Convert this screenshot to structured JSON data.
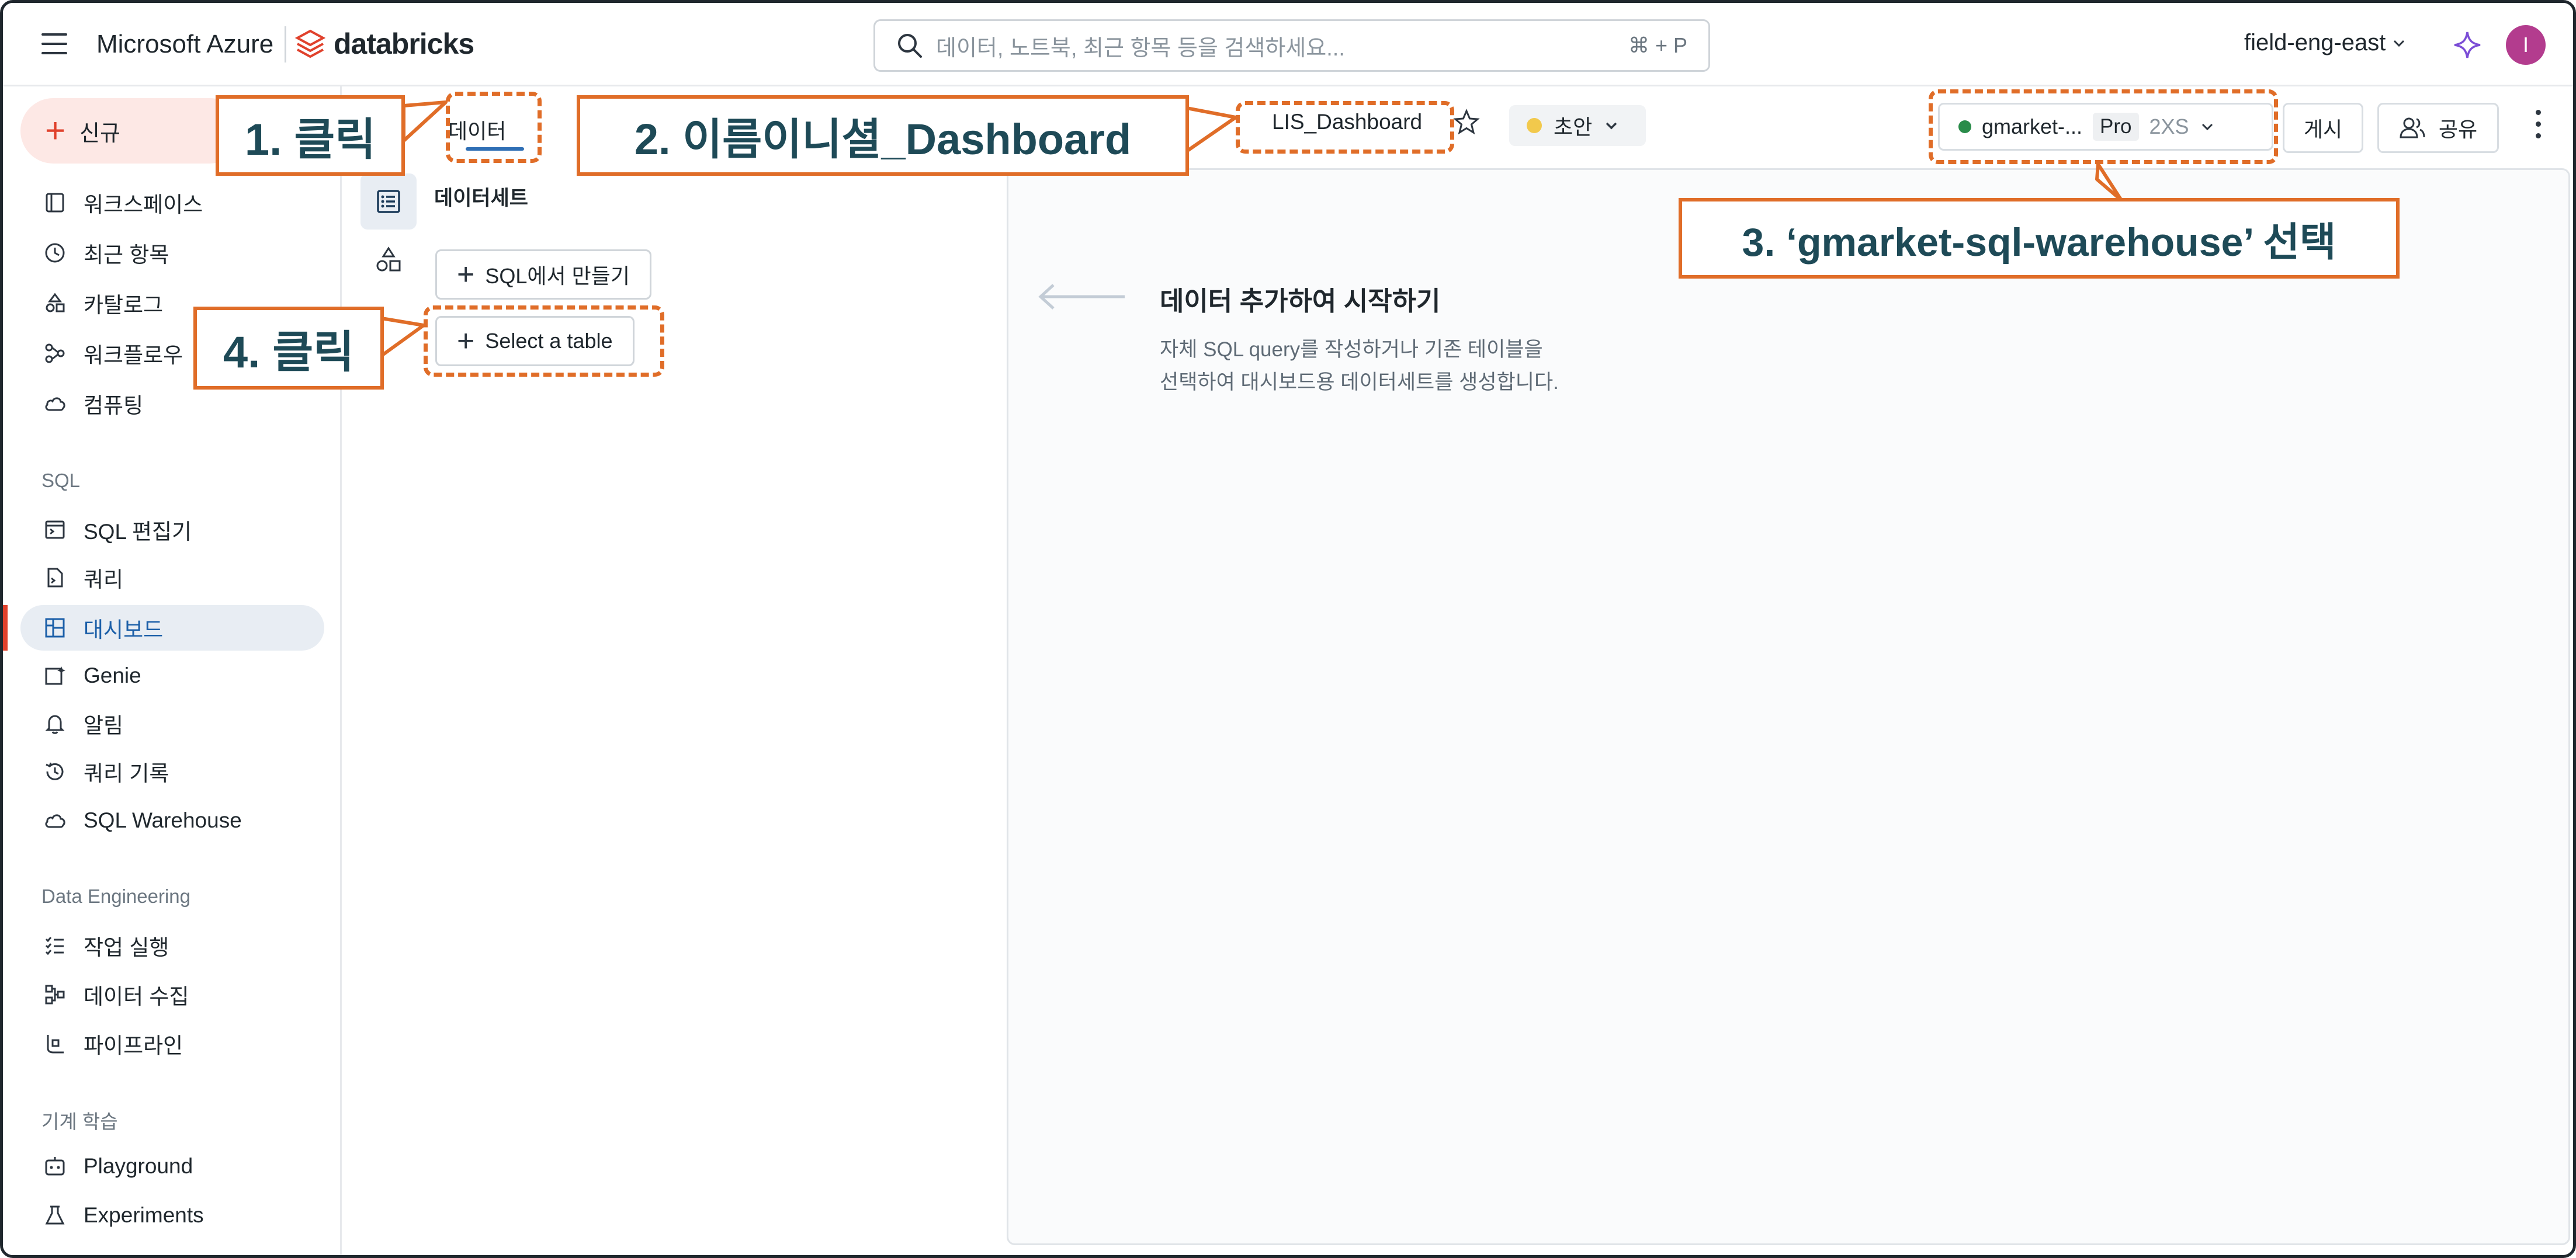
{
  "topbar": {
    "cloud_name": "Microsoft Azure",
    "brand_name": "databricks",
    "search_placeholder": "데이터, 노트북, 최근 항목 등을 검색하세요...",
    "search_shortcut": "⌘ + P",
    "workspace_name": "field-eng-east",
    "avatar_initial": "I"
  },
  "sidebar": {
    "new_label": "신규",
    "items": [
      {
        "label": "워크스페이스",
        "icon": "workspace-icon"
      },
      {
        "label": "최근 항목",
        "icon": "clock-icon"
      },
      {
        "label": "카탈로그",
        "icon": "catalog-icon"
      },
      {
        "label": "워크플로우",
        "icon": "workflow-icon"
      },
      {
        "label": "컴퓨팅",
        "icon": "cloud-icon"
      }
    ],
    "sql_section": "SQL",
    "sql_items": [
      {
        "label": "SQL 편집기",
        "icon": "sql-editor-icon"
      },
      {
        "label": "쿼리",
        "icon": "query-icon"
      },
      {
        "label": "대시보드",
        "icon": "dashboard-icon",
        "active": true
      },
      {
        "label": "Genie",
        "icon": "genie-icon"
      },
      {
        "label": "알림",
        "icon": "bell-icon"
      },
      {
        "label": "쿼리 기록",
        "icon": "history-icon"
      },
      {
        "label": "SQL Warehouse",
        "icon": "warehouse-icon"
      }
    ],
    "de_section": "Data Engineering",
    "de_items": [
      {
        "label": "작업 실행",
        "icon": "job-runs-icon"
      },
      {
        "label": "데이터 수집",
        "icon": "ingest-icon"
      },
      {
        "label": "파이프라인",
        "icon": "pipeline-icon"
      }
    ],
    "ml_section": "기계 학습",
    "ml_items": [
      {
        "label": "Playground",
        "icon": "playground-icon"
      },
      {
        "label": "Experiments",
        "icon": "experiments-icon"
      }
    ]
  },
  "dashboard": {
    "tab_data": "데이터",
    "title": "LIS_Dashboard",
    "status": "초안",
    "warehouse_name": "gmarket-...",
    "warehouse_tier": "Pro",
    "warehouse_size": "2XS",
    "publish_label": "게시",
    "share_label": "공유"
  },
  "data_panel": {
    "datasets_label": "데이터세트",
    "create_from_sql": "SQL에서 만들기",
    "select_table": "Select a table"
  },
  "empty_state": {
    "title": "데이터 추가하여 시작하기",
    "desc_line1": "자체 SQL query를 작성하거나 기존 테이블을",
    "desc_line2": "선택하여 대시보드용 데이터세트를 생성합니다."
  },
  "annotations": {
    "step1": "1. 클릭",
    "step2": "2. 이름이니셜_Dashboard",
    "step3": "3. ‘gmarket-sql-warehouse’ 선택",
    "step4": "4. 클릭"
  },
  "colors": {
    "accent": "#e06d28",
    "annotation_text": "#1e4a57",
    "brand_red": "#e0412c",
    "active_blue": "#1b5fa8"
  }
}
